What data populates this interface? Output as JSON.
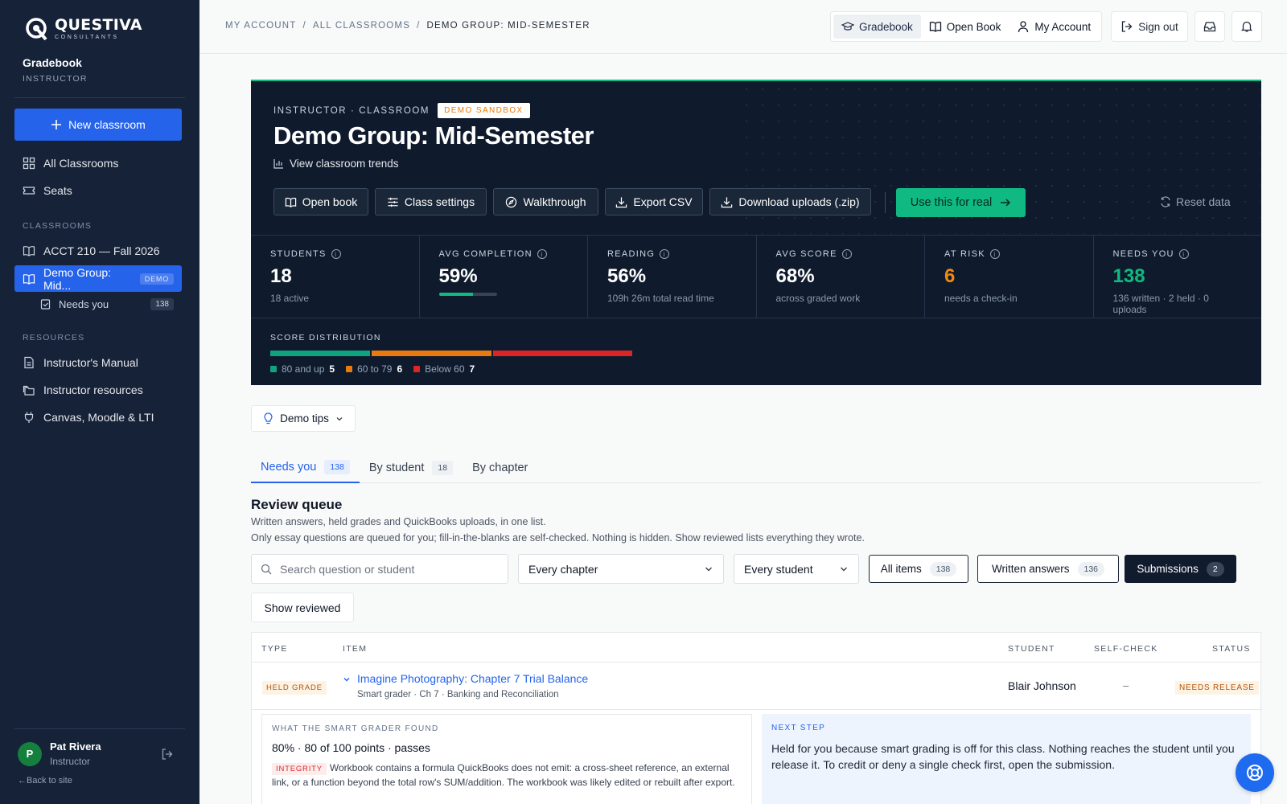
{
  "brand": {
    "name": "QUESTIVA",
    "sub": "CONSULTANTS"
  },
  "sidebar": {
    "app_title": "Gradebook",
    "app_role": "INSTRUCTOR",
    "new_btn": "New classroom",
    "items": [
      {
        "label": "All Classrooms",
        "icon": "grid-icon"
      },
      {
        "label": "Seats",
        "icon": "ticket-icon"
      }
    ],
    "classrooms_label": "CLASSROOMS",
    "classrooms": [
      {
        "label": "ACCT 210 — Fall 2026"
      },
      {
        "label": "Demo Group: Mid...",
        "badge": "DEMO"
      }
    ],
    "sub_item": {
      "label": "Needs you",
      "count": "138"
    },
    "resources_label": "RESOURCES",
    "resources": [
      {
        "label": "Instructor's Manual"
      },
      {
        "label": "Instructor resources"
      },
      {
        "label": "Canvas, Moodle & LTI"
      }
    ],
    "user": {
      "initial": "P",
      "name": "Pat Rivera",
      "role": "Instructor"
    },
    "back": "←Back to site"
  },
  "topbar": {
    "crumbs": [
      "MY ACCOUNT",
      "/",
      "ALL CLASSROOMS",
      "/",
      "DEMO GROUP: MID-SEMESTER"
    ],
    "gradebook": "Gradebook",
    "open_book": "Open Book",
    "my_account": "My Account",
    "sign_out": "Sign out"
  },
  "hero": {
    "eyebrow": "INSTRUCTOR · CLASSROOM",
    "sandbox": "DEMO SANDBOX",
    "title": "Demo Group: Mid-Semester",
    "trends": "View classroom trends",
    "buttons": [
      "Open book",
      "Class settings",
      "Walkthrough",
      "Export CSV",
      "Download uploads (.zip)"
    ],
    "real": "Use this for real",
    "reset": "Reset data",
    "stats": [
      {
        "label": "STUDENTS",
        "value": "18",
        "sub": "18 active"
      },
      {
        "label": "AVG COMPLETION",
        "value": "59%",
        "progress": 0.59
      },
      {
        "label": "READING",
        "value": "56%",
        "sub": "109h 26m total read time"
      },
      {
        "label": "AVG SCORE",
        "value": "68%",
        "sub": "across graded work"
      },
      {
        "label": "AT RISK",
        "value": "6",
        "sub": "needs a check-in"
      },
      {
        "label": "NEEDS YOU",
        "value": "138",
        "sub": "136 written · 2 held · 0 uploads"
      }
    ],
    "dist_label": "SCORE DISTRIBUTION",
    "dist": [
      {
        "label": "80 and up",
        "count": "5",
        "color": "#10a37f",
        "n": 5
      },
      {
        "label": "60 to 79",
        "count": "6",
        "color": "#ea7a10",
        "n": 6
      },
      {
        "label": "Below 60",
        "count": "7",
        "color": "#dc2626",
        "n": 7
      }
    ]
  },
  "tips": "Demo tips",
  "tabs": [
    {
      "label": "Needs you",
      "count": "138"
    },
    {
      "label": "By student",
      "count": "18"
    },
    {
      "label": "By chapter",
      "count": ""
    }
  ],
  "queue": {
    "title": "Review queue",
    "sub1": "Written answers, held grades and QuickBooks uploads, in one list.",
    "sub2": "Only essay questions are queued for you; fill-in-the-blanks are self-checked. Nothing is hidden. Show reviewed lists everything they wrote.",
    "search_placeholder": "Search question or student",
    "chapter": "Every chapter",
    "student": "Every student",
    "filters": [
      {
        "label": "All items",
        "count": "138"
      },
      {
        "label": "Written answers",
        "count": "136"
      },
      {
        "label": "Submissions",
        "count": "2"
      }
    ],
    "show_reviewed": "Show reviewed"
  },
  "table": {
    "headers": [
      "TYPE",
      "ITEM",
      "STUDENT",
      "SELF-CHECK",
      "STATUS"
    ],
    "row": {
      "type": "HELD GRADE",
      "title": "Imagine Photography: Chapter 7 Trial Balance",
      "sub": "Smart grader · Ch 7 · Banking and Reconciliation",
      "student": "Blair Johnson",
      "self_check": "–",
      "status": "NEEDS RELEASE"
    },
    "found": {
      "label": "WHAT THE SMART GRADER FOUND",
      "value": "80% · 80 of 100 points · passes",
      "tag": "INTEGRITY",
      "text": "Workbook contains a formula QuickBooks does not emit: a cross-sheet reference, an external link, or a function beyond the total row's SUM/addition. The workbook was likely edited or rebuilt after export."
    },
    "next": {
      "label": "NEXT STEP",
      "text": "Held for you because smart grading is off for this class. Nothing reaches the student until you release it. To credit or deny a single check first, open the submission."
    }
  }
}
